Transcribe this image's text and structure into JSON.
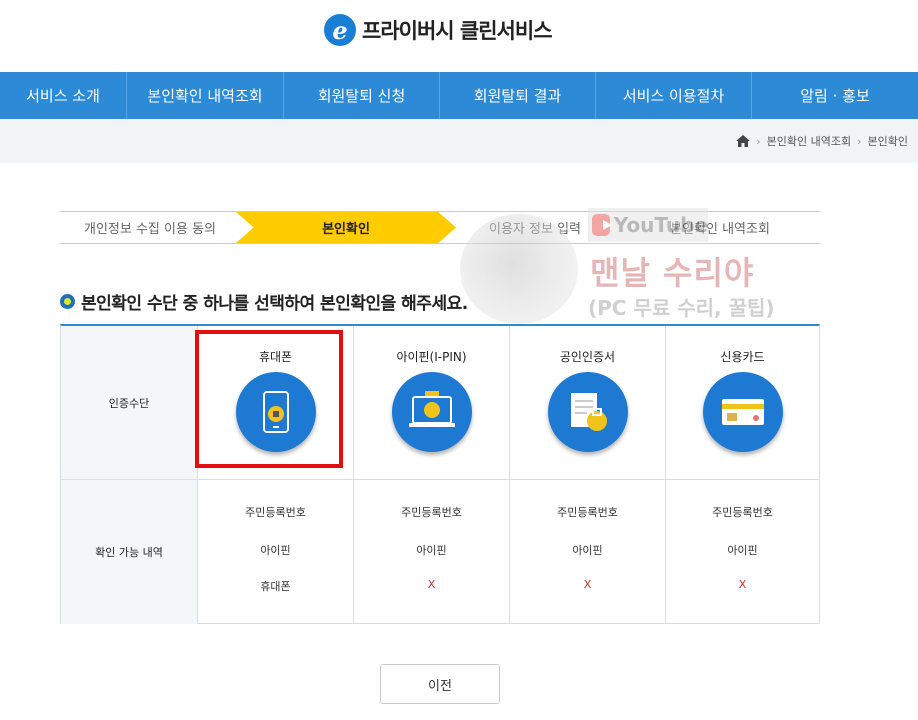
{
  "header": {
    "logo_letter": "e",
    "logo_text": "프라이버시 클린서비스"
  },
  "nav": [
    {
      "label": "서비스 소개"
    },
    {
      "label": "본인확인 내역조회"
    },
    {
      "label": "회원탈퇴 신청"
    },
    {
      "label": "회원탈퇴 결과"
    },
    {
      "label": "서비스 이용절차"
    },
    {
      "label": "알림 · 홍보"
    }
  ],
  "breadcrumb": {
    "items": [
      "본인확인 내역조회",
      "본인확인"
    ]
  },
  "steps": [
    "개인정보 수집 이용 동의",
    "본인확인",
    "이용자 정보 입력",
    "본인확인 내역조회"
  ],
  "active_step": 1,
  "main": {
    "title": "본인확인 수단 중 하나를 선택하여 본인확인을 해주세요."
  },
  "table": {
    "row1_header": "인증수단",
    "row2_header": "확인 가능 내역",
    "methods": [
      {
        "label": "휴대폰",
        "icon": "phone-lock-icon",
        "avail": [
          "주민등록번호",
          "아이핀",
          "휴대폰"
        ]
      },
      {
        "label": "아이핀(I-PIN)",
        "icon": "ipin-laptop-icon",
        "avail": [
          "주민등록번호",
          "아이핀",
          "X"
        ]
      },
      {
        "label": "공인인증서",
        "icon": "certificate-lock-icon",
        "avail": [
          "주민등록번호",
          "아이핀",
          "X"
        ]
      },
      {
        "label": "신용카드",
        "icon": "credit-card-icon",
        "avail": [
          "주민등록번호",
          "아이핀",
          "X"
        ]
      }
    ]
  },
  "prev_button": "이전",
  "watermark": {
    "youtube": "YouTube",
    "title": "맨날 수리야",
    "subtitle": "(PC 무료 수리, 꿀팁)"
  },
  "colors": {
    "nav": "#2c8ad7",
    "step_active": "#ffcc00",
    "highlight": "#e01010",
    "icon_circle": "#1d79d1"
  }
}
